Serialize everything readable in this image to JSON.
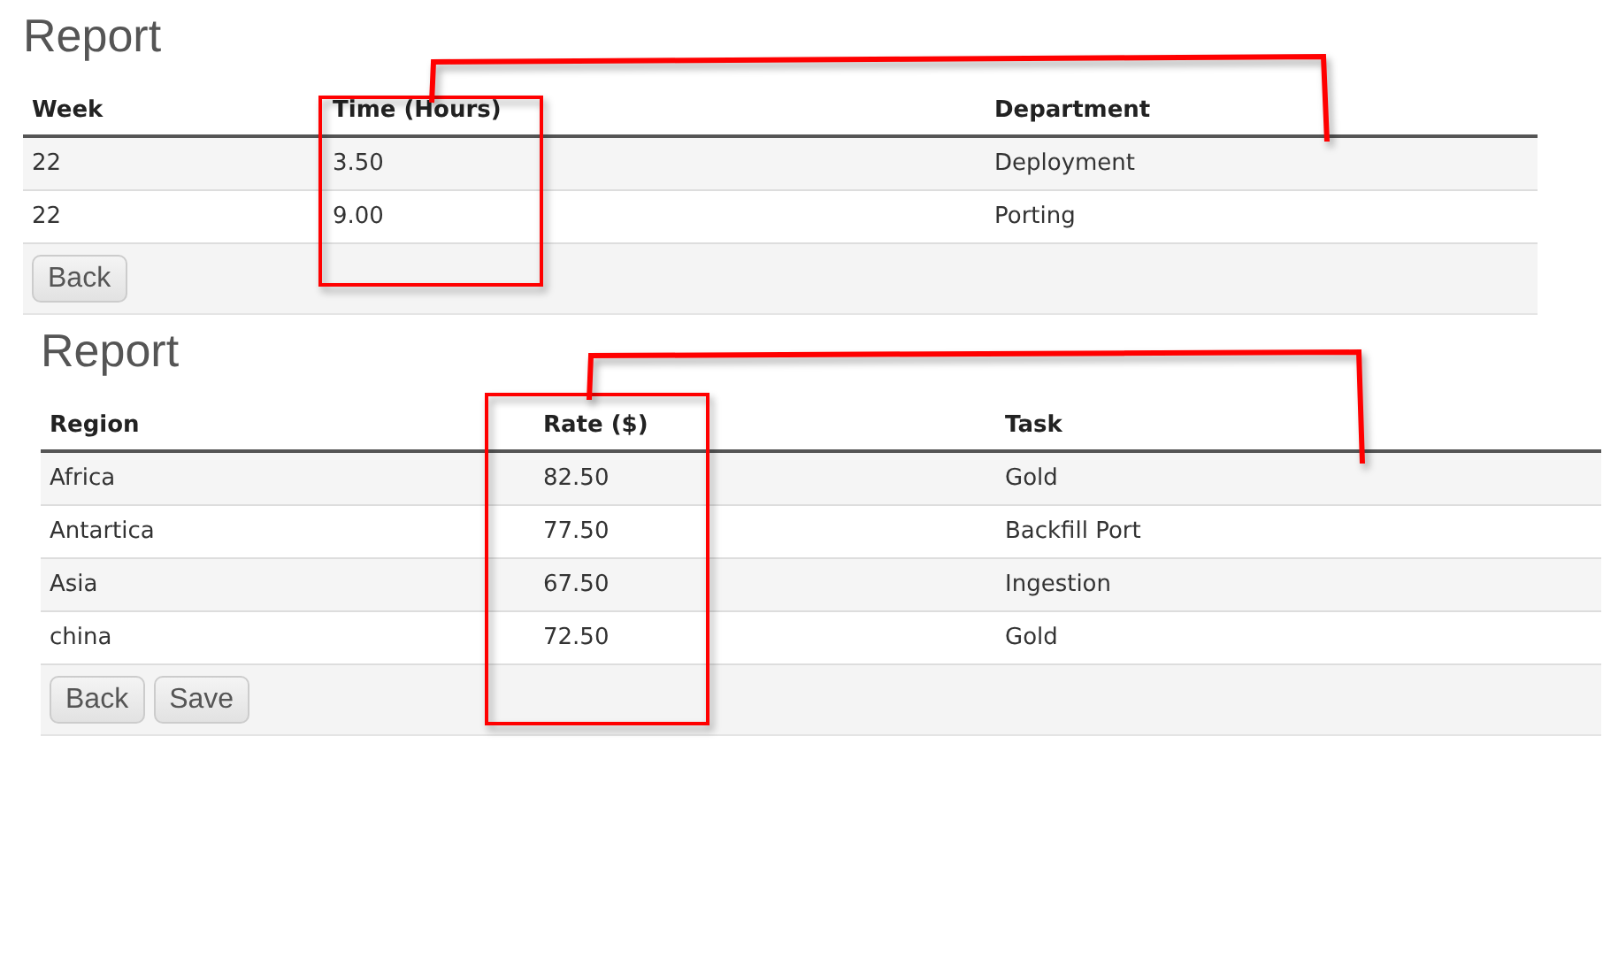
{
  "reports": [
    {
      "title": "Report",
      "columns": [
        "Week",
        "Time (Hours)",
        "Department"
      ],
      "rows": [
        [
          "22",
          "3.50",
          "Deployment"
        ],
        [
          "22",
          "9.00",
          "Porting"
        ]
      ],
      "buttons": [
        "Back"
      ]
    },
    {
      "title": "Report",
      "columns": [
        "Region",
        "Rate ($)",
        "Task"
      ],
      "rows": [
        [
          "Africa",
          "82.50",
          "Gold"
        ],
        [
          "Antartica",
          "77.50",
          "Backfill Port"
        ],
        [
          "Asia",
          "67.50",
          "Ingestion"
        ],
        [
          "china",
          "72.50",
          "Gold"
        ]
      ],
      "buttons": [
        "Back",
        "Save"
      ]
    }
  ]
}
